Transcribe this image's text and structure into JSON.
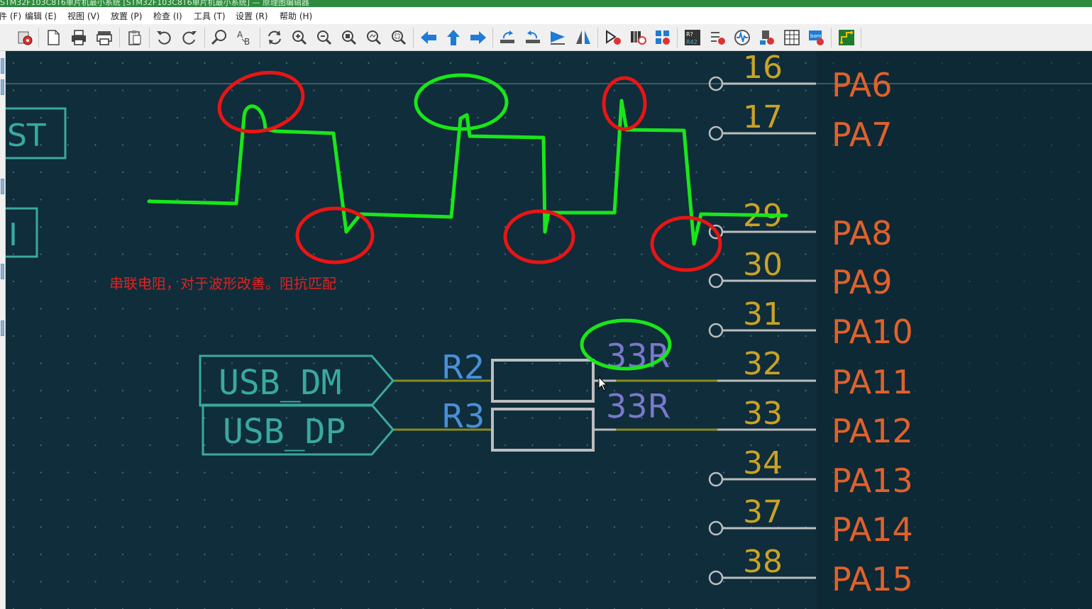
{
  "window": {
    "title": "STM32F103C8T6单片机最小系统 [STM32F103C8T6单片机最小系统] — 原理图编辑器"
  },
  "menu": {
    "items": [
      {
        "label": "文件 (F)"
      },
      {
        "label": "编辑 (E)"
      },
      {
        "label": "视图 (V)"
      },
      {
        "label": "放置 (P)"
      },
      {
        "label": "检查 (I)"
      },
      {
        "label": "工具 (T)"
      },
      {
        "label": "设置 (R)"
      },
      {
        "label": "帮助 (H)"
      }
    ]
  },
  "toolbar": {
    "buttons": [
      {
        "icon": "schematic-setup-icon"
      },
      {
        "icon": "page-settings-icon"
      },
      {
        "icon": "print-icon"
      },
      {
        "icon": "plot-icon"
      },
      {
        "icon": "paste-icon"
      },
      {
        "icon": "undo-icon"
      },
      {
        "icon": "redo-icon"
      },
      {
        "icon": "find-icon"
      },
      {
        "icon": "find-replace-icon"
      },
      {
        "icon": "refresh-icon"
      },
      {
        "icon": "zoom-in-icon"
      },
      {
        "icon": "zoom-out-icon"
      },
      {
        "icon": "zoom-fit-icon"
      },
      {
        "icon": "zoom-objects-icon"
      },
      {
        "icon": "zoom-selection-icon"
      },
      {
        "icon": "navigate-back-icon"
      },
      {
        "icon": "navigate-up-icon"
      },
      {
        "icon": "navigate-forward-icon"
      },
      {
        "icon": "rotate-ccw-icon"
      },
      {
        "icon": "rotate-cw-icon"
      },
      {
        "icon": "mirror-horizontal-icon"
      },
      {
        "icon": "mirror-vertical-icon"
      },
      {
        "icon": "symbol-editor-icon"
      },
      {
        "icon": "symbol-library-icon"
      },
      {
        "icon": "symbol-fields-icon"
      },
      {
        "icon": "annotate-icon"
      },
      {
        "icon": "erc-icon"
      },
      {
        "icon": "simulator-icon"
      },
      {
        "icon": "footprint-assign-icon"
      },
      {
        "icon": "fields-table-icon"
      },
      {
        "icon": "bom-icon"
      },
      {
        "icon": "pcb-editor-icon"
      }
    ]
  },
  "schematic": {
    "hier_labels": [
      {
        "text": "ST"
      },
      {
        "text": "I"
      }
    ],
    "global_labels": [
      {
        "text": "USB_DM"
      },
      {
        "text": "USB_DP"
      }
    ],
    "resistors": [
      {
        "ref": "R2",
        "value": "33R"
      },
      {
        "ref": "R3",
        "value": "33R"
      }
    ],
    "pins": [
      {
        "number": "16",
        "name": "PA6"
      },
      {
        "number": "17",
        "name": "PA7"
      },
      {
        "number": "29",
        "name": "PA8"
      },
      {
        "number": "30",
        "name": "PA9"
      },
      {
        "number": "31",
        "name": "PA10"
      },
      {
        "number": "32",
        "name": "PA11"
      },
      {
        "number": "33",
        "name": "PA12"
      },
      {
        "number": "34",
        "name": "PA13"
      },
      {
        "number": "37",
        "name": "PA14"
      },
      {
        "number": "38",
        "name": "PA15"
      }
    ],
    "annotation": "串联电阻，对于波形改善。阻抗匹配"
  },
  "colors": {
    "canvas_background": "#0f2d3a",
    "pin_number": "#c9a227",
    "pin_name": "#e0612c",
    "label_outline": "#3aa9a0",
    "wire": "#8a8a20",
    "resistor_ref": "#4a8fd8",
    "resistor_value": "#7a78cc",
    "annotation_text": "#e0211f",
    "sketch_green": "#19e619",
    "sketch_red": "#e81515"
  }
}
